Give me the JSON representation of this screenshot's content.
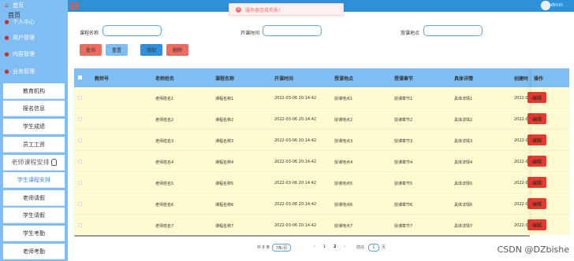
{
  "sidebar": {
    "overlap_label": "首页",
    "top_items": [
      {
        "label": "首页",
        "icon": "home-icon"
      },
      {
        "label": "个人中心",
        "icon": "user-icon"
      },
      {
        "label": "用户管理",
        "icon": "users-icon"
      },
      {
        "label": "内容管理",
        "icon": "content-icon"
      },
      {
        "label": "业务管理",
        "icon": "business-icon"
      }
    ],
    "sub_items": [
      {
        "label": "教育机构"
      },
      {
        "label": "报名信息"
      },
      {
        "label": "学生成绩"
      },
      {
        "label": "员工工资"
      },
      {
        "label": "老师课程安排",
        "active": true
      },
      {
        "label": "学生课程安排"
      },
      {
        "label": "老师请假"
      },
      {
        "label": "学生请假"
      },
      {
        "label": "学生考勤"
      },
      {
        "label": "老师考勤"
      }
    ]
  },
  "topbar": {
    "user": "admin",
    "colors": {
      "bar": "#2f8fd8",
      "grid_icon": "#e05a4a"
    }
  },
  "toast": {
    "text": "服务器连接失败!",
    "color": "#f56c6c"
  },
  "filters": {
    "course_name_label": "课程名称",
    "start_time_label": "开课时间",
    "location_label": "授课地点",
    "course_name_value": "",
    "start_time_value": "",
    "location_value": "",
    "query_label": "查询",
    "reset_label": "重置",
    "add_label": "添加",
    "delete_label": "删除"
  },
  "table": {
    "headers": [
      "教师号",
      "老师姓名",
      "课程名称",
      "开课时间",
      "授课地点",
      "授课章节",
      "具体详情",
      "创建时",
      "操作"
    ],
    "rows": [
      {
        "teacher_id": "",
        "name": "老师姓名1",
        "course": "课程名称1",
        "time": "2022-03-06 20:14:42",
        "location": "授课地点1",
        "chapter": "授课章节1",
        "detail": "具体详情1",
        "created": "2022-03",
        "action": "编辑"
      },
      {
        "teacher_id": "",
        "name": "老师姓名2",
        "course": "课程名称2",
        "time": "2022-03-06 20:14:42",
        "location": "授课地点2",
        "chapter": "授课章节2",
        "detail": "具体详情2",
        "created": "2022-03",
        "action": "编辑"
      },
      {
        "teacher_id": "",
        "name": "老师姓名3",
        "course": "课程名称3",
        "time": "2022-03-06 20:14:42",
        "location": "授课地点3",
        "chapter": "授课章节3",
        "detail": "具体详情3",
        "created": "2022-03",
        "action": "编辑"
      },
      {
        "teacher_id": "",
        "name": "老师姓名4",
        "course": "课程名称4",
        "time": "2022-03-06 20:14:42",
        "location": "授课地点4",
        "chapter": "授课章节4",
        "detail": "具体详情4",
        "created": "2022-03",
        "action": "编辑"
      },
      {
        "teacher_id": "",
        "name": "老师姓名5",
        "course": "课程名称5",
        "time": "2022-03-06 20:14:42",
        "location": "授课地点5",
        "chapter": "授课章节5",
        "detail": "具体详情5",
        "created": "2022-03",
        "action": "编辑"
      },
      {
        "teacher_id": "",
        "name": "老师姓名6",
        "course": "课程名称6",
        "time": "2022-03-06 20:14:42",
        "location": "授课地点6",
        "chapter": "授课章节6",
        "detail": "具体详情6",
        "created": "2022-03",
        "action": "编辑"
      },
      {
        "teacher_id": "",
        "name": "老师姓名7",
        "course": "课程名称7",
        "time": "2022-03-06 20:14:42",
        "location": "授课地点7",
        "chapter": "授课章节7",
        "detail": "具体详情7",
        "created": "2022-03",
        "action": "编辑"
      }
    ]
  },
  "pagination": {
    "total": "共 8 条",
    "page_size": "7条/页",
    "prev": "‹",
    "pages": [
      "1",
      "2"
    ],
    "next": "›",
    "goto_label": "前往",
    "goto_value": "1",
    "page_unit": "页"
  },
  "watermark": "CSDN @DZbishe"
}
